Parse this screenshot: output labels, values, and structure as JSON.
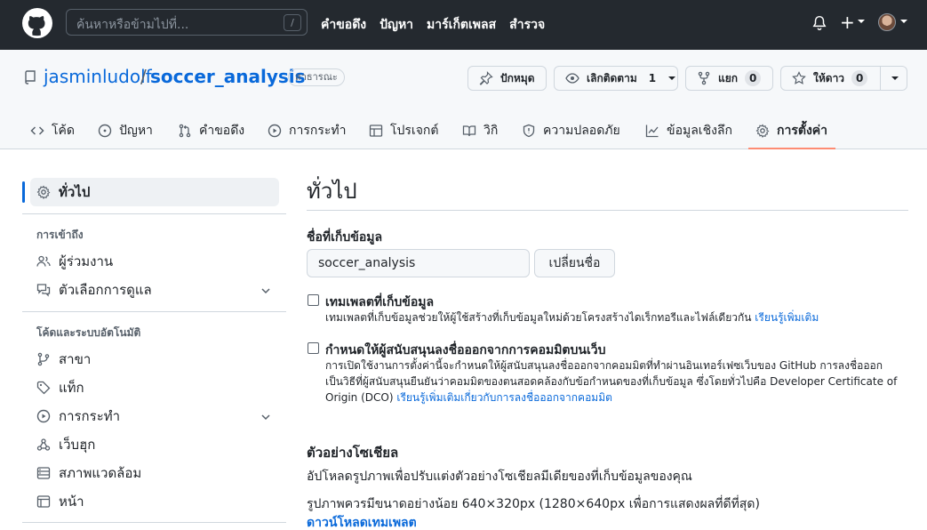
{
  "header": {
    "search_placeholder": "ค้นหาหรือข้ามไปที่...",
    "search_shortcut": "/",
    "nav": [
      "คำขอดึง",
      "ปัญหา",
      "มาร์เก็ตเพลส",
      "สำรวจ"
    ],
    "plus": "+"
  },
  "repo": {
    "owner": "jasminludolf",
    "separator": "/",
    "name": "soccer_analysis",
    "visibility": "สาธารณะ",
    "pin_label": "ปักหมุด",
    "watch_label": "เลิกติดตาม",
    "watch_count": "1",
    "fork_label": "แยก",
    "fork_count": "0",
    "star_label": "ให้ดาว",
    "star_count": "0"
  },
  "tabs": [
    {
      "label": "โค้ด",
      "icon": "code-icon"
    },
    {
      "label": "ปัญหา",
      "icon": "issue-icon"
    },
    {
      "label": "คำขอดึง",
      "icon": "pull-request-icon"
    },
    {
      "label": "การกระทำ",
      "icon": "play-icon"
    },
    {
      "label": "โปรเจกต์",
      "icon": "table-icon"
    },
    {
      "label": "วิกิ",
      "icon": "book-icon"
    },
    {
      "label": "ความปลอดภัย",
      "icon": "shield-icon"
    },
    {
      "label": "ข้อมูลเชิงลึก",
      "icon": "graph-icon"
    },
    {
      "label": "การตั้งค่า",
      "icon": "gear-icon",
      "active": true
    }
  ],
  "sidebar": {
    "general": "ทั่วไป",
    "access_heading": "การเข้าถึง",
    "collaborators": "ผู้ร่วมงาน",
    "moderation": "ตัวเลือกการดูแล",
    "code_heading": "โค้ดและระบบอัตโนมัติ",
    "branches": "สาขา",
    "tags": "แท็ก",
    "actions": "การกระทำ",
    "webhooks": "เว็บฮุก",
    "environments": "สภาพแวดล้อม",
    "pages": "หน้า"
  },
  "main": {
    "title": "ทั่วไป",
    "repo_name_label": "ชื่อที่เก็บข้อมูล",
    "repo_name_value": "soccer_analysis",
    "rename_button": "เปลี่ยนชื่อ",
    "template_title": "เทมเพลตที่เก็บข้อมูล",
    "template_desc": "เทมเพลตที่เก็บข้อมูลช่วยให้ผู้ใช้สร้างที่เก็บข้อมูลใหม่ด้วยโครงสร้างไดเร็กทอรีและไฟล์เดียวกัน",
    "template_link": "เรียนรู้เพิ่มเติม",
    "signoff_title": "กำหนดให้ผู้สนับสนุนลงชื่อออกจากการคอมมิตบนเว็บ",
    "signoff_desc_1": "การเปิดใช้งานการตั้งค่านี้จะกำหนดให้ผู้สนับสนุนลงชื่อออกจากคอมมิตที่ทำผ่านอินเทอร์เฟซเว็บของ GitHub การลงชื่อออก",
    "signoff_desc_2": "เป็นวิธีที่ผู้สนับสนุนยืนยันว่าคอมมิตของตนสอดคล้องกับข้อกำหนดของที่เก็บข้อมูล ซึ่งโดยทั่วไปคือ Developer Certificate of",
    "signoff_desc_3": "Origin (DCO)",
    "signoff_link": "เรียนรู้เพิ่มเติมเกี่ยวกับการลงชื่อออกจากคอมมิต",
    "social_title": "ตัวอย่างโซเชียล",
    "social_desc": "อัปโหลดรูปภาพเพื่อปรับแต่งตัวอย่างโซเชียลมีเดียของที่เก็บข้อมูลของคุณ",
    "social_size": "รูปภาพควรมีขนาดอย่างน้อย 640×320px (1280×640px เพื่อการแสดงผลที่ดีที่สุด)",
    "download_template": "ดาวน์โหลดเทมเพลต"
  }
}
